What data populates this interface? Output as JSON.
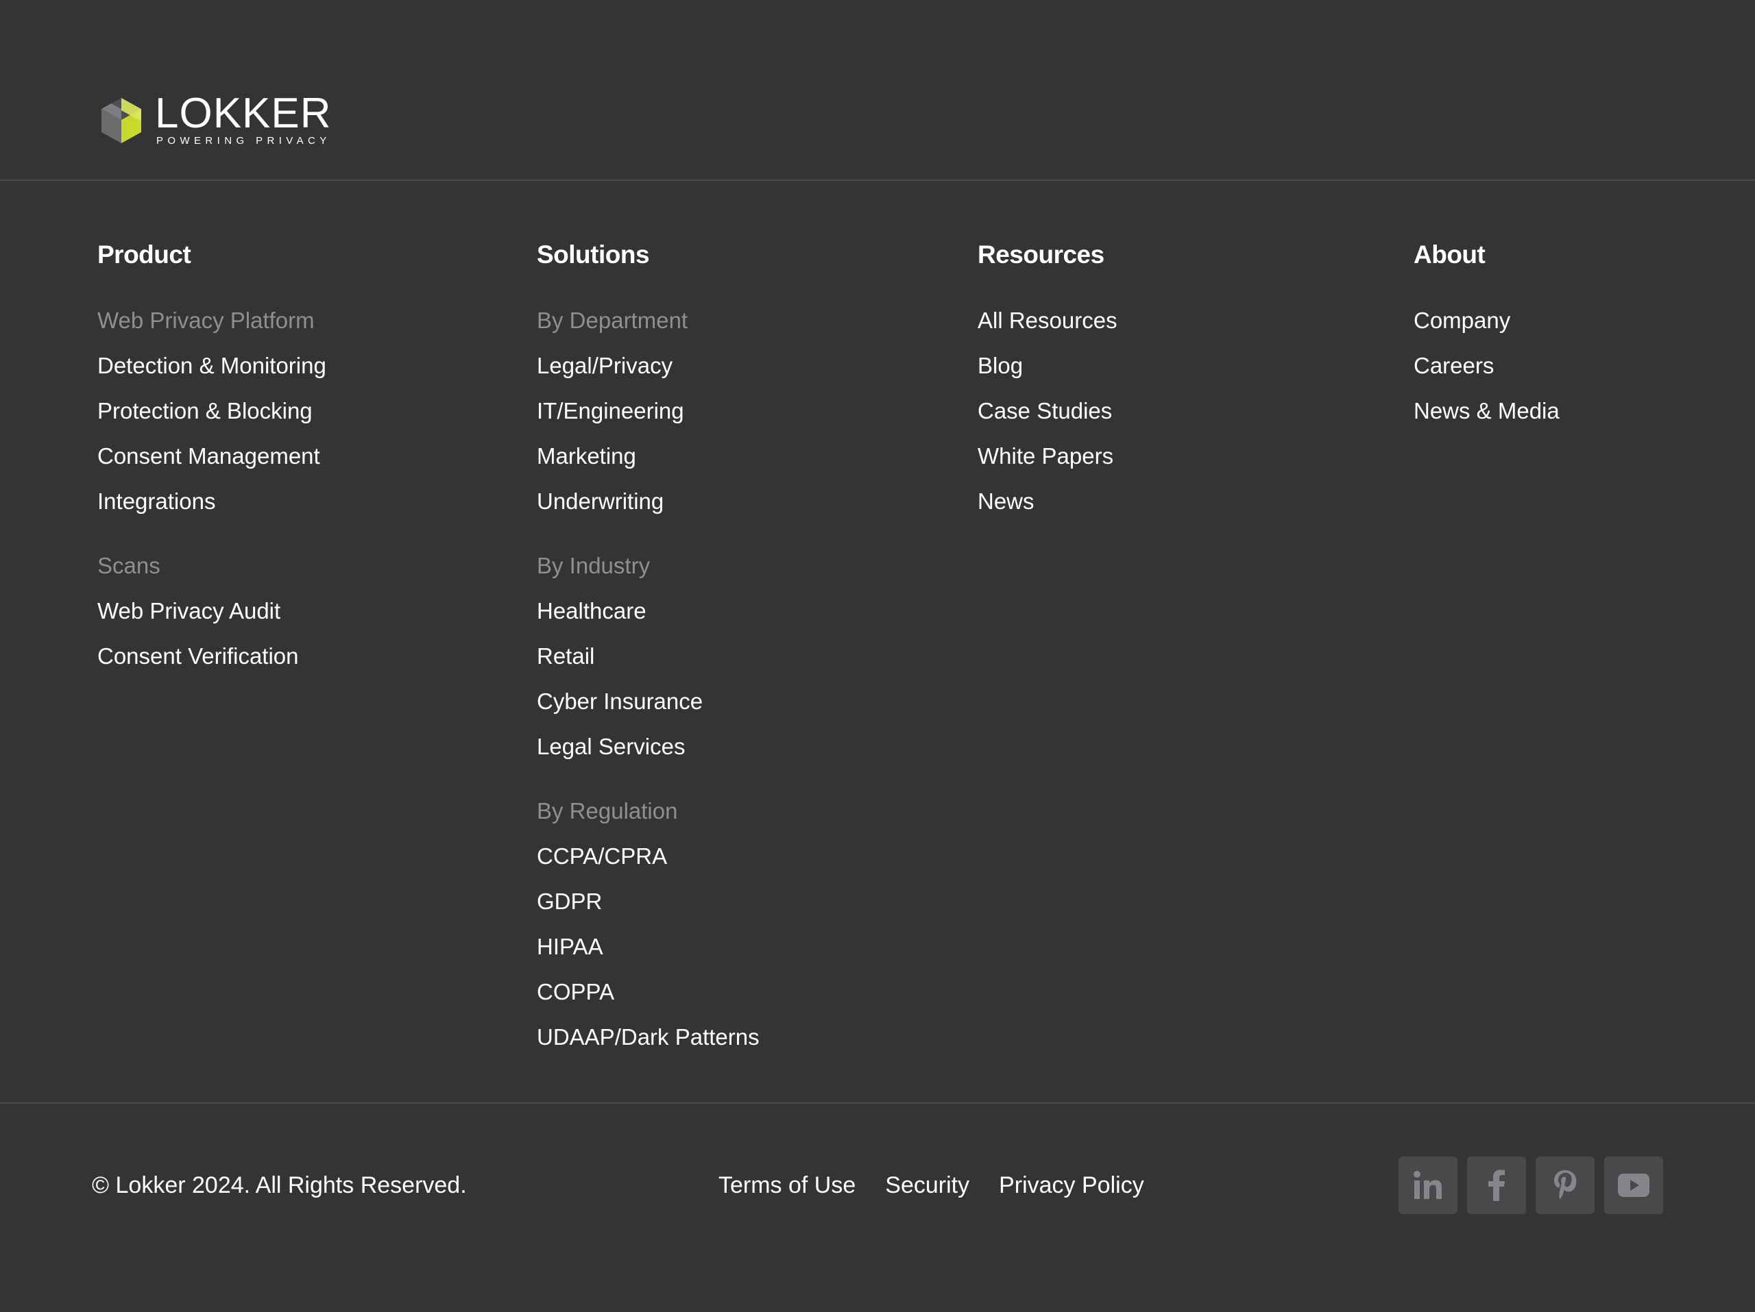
{
  "logo": {
    "wordmark": "LOKKER",
    "tagline": "POWERING PRIVACY",
    "colors": {
      "accent": "#c8d92b",
      "mark_gray": "#6a6b6d"
    }
  },
  "columns": {
    "product": {
      "heading": "Product",
      "items": [
        {
          "label": "Web Privacy Platform",
          "type": "subheading"
        },
        {
          "label": "Detection & Monitoring",
          "type": "link"
        },
        {
          "label": "Protection & Blocking",
          "type": "link"
        },
        {
          "label": "Consent Management",
          "type": "link"
        },
        {
          "label": "Integrations",
          "type": "link"
        },
        {
          "label": "Scans",
          "type": "subheading"
        },
        {
          "label": "Web Privacy Audit",
          "type": "link"
        },
        {
          "label": "Consent Verification",
          "type": "link"
        }
      ]
    },
    "solutions": {
      "heading": "Solutions",
      "items": [
        {
          "label": "By Department",
          "type": "subheading"
        },
        {
          "label": "Legal/Privacy",
          "type": "link"
        },
        {
          "label": "IT/Engineering",
          "type": "link"
        },
        {
          "label": "Marketing",
          "type": "link"
        },
        {
          "label": "Underwriting",
          "type": "link"
        },
        {
          "label": "By Industry",
          "type": "subheading"
        },
        {
          "label": "Healthcare",
          "type": "link"
        },
        {
          "label": "Retail",
          "type": "link"
        },
        {
          "label": "Cyber Insurance",
          "type": "link"
        },
        {
          "label": "Legal Services",
          "type": "link"
        },
        {
          "label": "By Regulation",
          "type": "subheading"
        },
        {
          "label": "CCPA/CPRA",
          "type": "link"
        },
        {
          "label": "GDPR",
          "type": "link"
        },
        {
          "label": "HIPAA",
          "type": "link"
        },
        {
          "label": "COPPA",
          "type": "link"
        },
        {
          "label": "UDAAP/Dark Patterns",
          "type": "link"
        }
      ]
    },
    "resources": {
      "heading": "Resources",
      "items": [
        {
          "label": "All Resources",
          "type": "link"
        },
        {
          "label": "Blog",
          "type": "link"
        },
        {
          "label": "Case Studies",
          "type": "link"
        },
        {
          "label": "White Papers",
          "type": "link"
        },
        {
          "label": "News",
          "type": "link"
        }
      ]
    },
    "about": {
      "heading": "About",
      "items": [
        {
          "label": "Company",
          "type": "link"
        },
        {
          "label": "Careers",
          "type": "link"
        },
        {
          "label": "News & Media",
          "type": "link"
        }
      ]
    }
  },
  "bottom": {
    "copyright": "© Lokker 2024. All Rights Reserved.",
    "legal_links": {
      "terms": "Terms of Use",
      "security": "Security",
      "privacy": "Privacy Policy"
    },
    "social": [
      "linkedin-icon",
      "facebook-icon",
      "pinterest-icon",
      "youtube-icon"
    ]
  },
  "colors": {
    "background": "#333436",
    "divider": "#48494b",
    "subheading": "#8e8f91",
    "social_bg": "#48494b",
    "social_icon": "#858689"
  }
}
